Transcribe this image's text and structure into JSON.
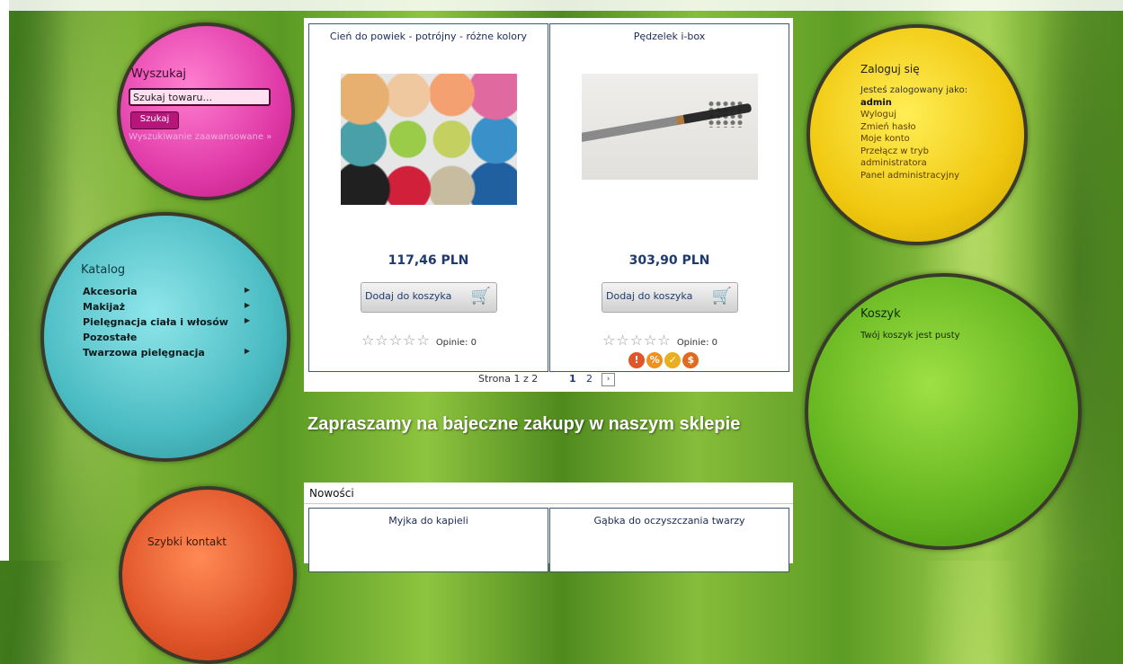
{
  "search": {
    "title": "Wyszukaj",
    "input_value": "Szukaj towaru...",
    "button_label": "Szukaj",
    "advanced_link": "Wyszukiwanie zaawansowane »"
  },
  "catalog": {
    "title": "Katalog",
    "items": [
      {
        "label": "Akcesoria",
        "has_submenu": true
      },
      {
        "label": "Makijaż",
        "has_submenu": true
      },
      {
        "label": "Pielęgnacja ciała i włosów",
        "has_submenu": true
      },
      {
        "label": "Pozostałe",
        "has_submenu": false
      },
      {
        "label": "Twarzowa pielęgnacja",
        "has_submenu": true
      }
    ]
  },
  "contact": {
    "title": "Szybki kontakt"
  },
  "login": {
    "title": "Zaloguj się",
    "logged_as": "Jesteś zalogowany jako:",
    "username": "admin",
    "links": [
      "Wyloguj",
      "Zmień hasło",
      "Moje konto",
      "Przełącz w tryb administratora",
      "Panel administracyjny"
    ]
  },
  "cart": {
    "title": "Koszyk",
    "empty_text": "Twój koszyk jest pusty"
  },
  "products": [
    {
      "name": "Cień do powiek - potrójny - różne kolory",
      "price": "117,46 PLN",
      "cart_button": "Dodaj do koszyka",
      "stars": "☆☆☆☆☆",
      "reviews": "Opinie: 0"
    },
    {
      "name": "Pędzelek i-box",
      "price": "303,90 PLN",
      "cart_button": "Dodaj do koszyka",
      "stars": "☆☆☆☆☆",
      "reviews": "Opinie: 0",
      "badges": [
        "!",
        "%",
        "✓",
        "$"
      ]
    }
  ],
  "pagination": {
    "label": "Strona 1 z 2",
    "current": "1",
    "next_page": "2",
    "next_icon": "›"
  },
  "welcome_text": "Zapraszamy na bajeczne zakupy w naszym sklepie",
  "news": {
    "title": "Nowości",
    "items": [
      {
        "name": "Myjka do kapieli"
      },
      {
        "name": "Gąbka do oczyszczania twarzy"
      }
    ]
  },
  "colors": {
    "search_bubble": "#e03aa8",
    "catalog_bubble": "#4bbcc3",
    "contact_bubble": "#e0552a",
    "login_bubble": "#f0c810",
    "cart_bubble": "#63b41f",
    "price": "#1e3a6e"
  }
}
